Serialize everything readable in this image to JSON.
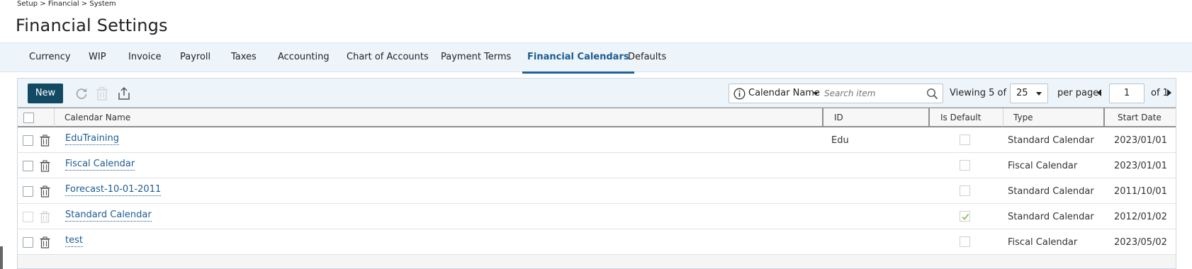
{
  "breadcrumb": "Setup > Financial > System",
  "page_title": "Financial Settings",
  "tabs": [
    {
      "label": "Currency"
    },
    {
      "label": "WIP"
    },
    {
      "label": "Invoice"
    },
    {
      "label": "Payroll"
    },
    {
      "label": "Taxes"
    },
    {
      "label": "Accounting"
    },
    {
      "label": "Chart of Accounts"
    },
    {
      "label": "Payment Terms"
    },
    {
      "label": "Financial Calendars",
      "active": true
    },
    {
      "label": "Defaults"
    }
  ],
  "toolbar": {
    "new_label": "New",
    "search_field": "Calendar Name",
    "search_placeholder": "Search item",
    "viewing_prefix": "Viewing",
    "viewing_value": "5 of 5",
    "per_page_value": "25",
    "per_page_label": "per page",
    "page_value": "1",
    "page_of": "of 1"
  },
  "columns": {
    "name": "Calendar Name",
    "id": "ID",
    "is_default": "Is Default",
    "type": "Type",
    "start_date": "Start Date"
  },
  "rows": [
    {
      "name": "EduTraining",
      "id": "Edu",
      "is_default": false,
      "type": "Standard Calendar",
      "start_date": "2023/01/01",
      "deletable": true
    },
    {
      "name": "Fiscal Calendar",
      "id": "",
      "is_default": false,
      "type": "Fiscal Calendar",
      "start_date": "2023/01/01",
      "deletable": true
    },
    {
      "name": "Forecast-10-01-2011",
      "id": "",
      "is_default": false,
      "type": "Standard Calendar",
      "start_date": "2011/10/01",
      "deletable": true
    },
    {
      "name": "Standard Calendar",
      "id": "",
      "is_default": true,
      "type": "Standard Calendar",
      "start_date": "2012/01/02",
      "deletable": false
    },
    {
      "name": "test",
      "id": "",
      "is_default": false,
      "type": "Fiscal Calendar",
      "start_date": "2023/05/02",
      "deletable": true
    }
  ],
  "colors": {
    "accent": "#1c5c93",
    "new_button": "#124a63",
    "tabbar_bg": "#eef5fa",
    "check_green": "#7cb342"
  }
}
